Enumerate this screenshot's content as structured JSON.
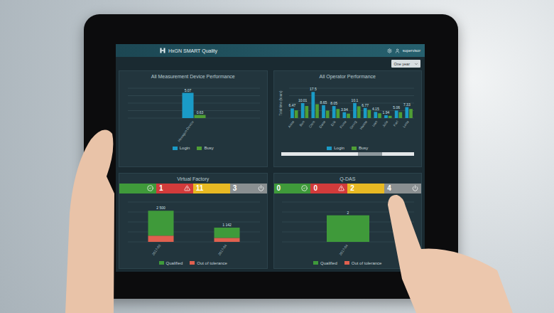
{
  "app": {
    "title": "HxGN SMART Quality",
    "user": "supervisor",
    "period": "One year"
  },
  "panels": [
    {
      "title": "All Measurement Device Performance",
      "kind": "grouped",
      "max": 6,
      "categories": [
        "Hexagon Device"
      ],
      "series": [
        {
          "name": "Login",
          "color": "#1a9bc7",
          "values": [
            5.07
          ],
          "labels": [
            "5.07"
          ]
        },
        {
          "name": "Busy",
          "color": "#4f9e35",
          "values": [
            0.63
          ],
          "labels": [
            "0.63"
          ]
        }
      ]
    },
    {
      "title": "All Operator Performance",
      "kind": "grouped",
      "max": 20,
      "axis_label": "Total time (hours)",
      "categories": [
        "Anna",
        "Ben",
        "Chris",
        "Dana",
        "Erik",
        "Fiona",
        "Georg",
        "Hanna",
        "Ivan",
        "Julia",
        "Karl",
        "Lena"
      ],
      "series": [
        {
          "name": "Login",
          "color": "#1a9bc7",
          "values": [
            6.47,
            10.01,
            17.5,
            8.65,
            8.05,
            3.94,
            10.1,
            6.77,
            4.15,
            1.94,
            5.06,
            7.33
          ],
          "labels": [
            "6.47",
            "10.01",
            "17.5",
            "8.65",
            "8.05",
            "3.94",
            "10.1",
            "6.77",
            "4.15",
            "1.94",
            "5.06",
            "7.33"
          ]
        },
        {
          "name": "Busy",
          "color": "#4f9e35",
          "values": [
            5.2,
            8.1,
            9.3,
            5.0,
            6.1,
            3.0,
            7.9,
            5.5,
            3.2,
            1.5,
            4.0,
            6.1
          ],
          "labels": []
        }
      ],
      "scrollbar": {
        "start": 0.58,
        "level": 0.18
      }
    },
    {
      "title": "Virtual Factory",
      "kind": "stacked",
      "max": 3200,
      "status": [
        {
          "color": "#3f9a3a"
        },
        {
          "count": "1",
          "color": "#d23b3b"
        },
        {
          "count": "11",
          "color": "#e8b923"
        },
        {
          "count": "3",
          "color": "#8a8f91"
        }
      ],
      "categories": [
        "2017-03",
        "2017-04"
      ],
      "totals": [
        "2 500",
        "1 142"
      ],
      "series": [
        {
          "name": "Qualified",
          "color": "#3f9a3a",
          "values": [
            2000,
            820
          ]
        },
        {
          "name": "Out of tolerance",
          "color": "#e0604f",
          "values": [
            500,
            322
          ]
        }
      ]
    },
    {
      "title": "Q-DAS",
      "kind": "stacked",
      "max": 3,
      "status": [
        {
          "count": "0",
          "color": "#3f9a3a"
        },
        {
          "count": "0",
          "color": "#d23b3b"
        },
        {
          "count": "2",
          "color": "#e8b923"
        },
        {
          "count": "4",
          "color": "#8a8f91"
        }
      ],
      "categories": [
        "2017-04"
      ],
      "totals": [
        "2"
      ],
      "series": [
        {
          "name": "Qualified",
          "color": "#3f9a3a",
          "values": [
            2
          ]
        },
        {
          "name": "Out of tolerance",
          "color": "#e0604f",
          "values": [
            0
          ]
        }
      ]
    }
  ]
}
